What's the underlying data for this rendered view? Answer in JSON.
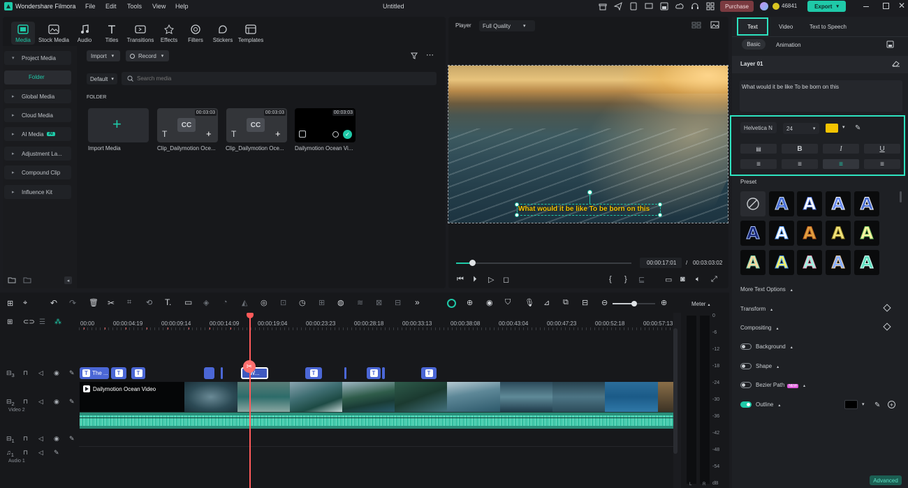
{
  "app": {
    "name": "Wondershare Filmora",
    "doc_title": "Untitled"
  },
  "menu": [
    "File",
    "Edit",
    "Tools",
    "View",
    "Help"
  ],
  "topbar": {
    "purchase": "Purchase",
    "credits": "46841",
    "export": "Export"
  },
  "media_tabs": [
    "Media",
    "Stock Media",
    "Audio",
    "Titles",
    "Transitions",
    "Effects",
    "Filters",
    "Stickers",
    "Templates"
  ],
  "sidebar": {
    "project_media": "Project Media",
    "folder": "Folder",
    "items": [
      "Global Media",
      "Cloud Media",
      "AI Media",
      "Adjustment La...",
      "Compound Clip",
      "Influence Kit"
    ],
    "ai_badge": "AI"
  },
  "media_toolbar": {
    "import": "Import",
    "record": "Record",
    "sort": "Default",
    "search_placeholder": "Search media"
  },
  "folder_label": "FOLDER",
  "media_items": [
    {
      "label": "Import Media",
      "duration": ""
    },
    {
      "label": "Clip_Dailymotion Oce...",
      "duration": "00:03:03",
      "tag": "CC"
    },
    {
      "label": "Clip_Dailymotion Oce...",
      "duration": "00:03:03",
      "tag": "CC"
    },
    {
      "label": "Dailymotion Ocean Vi...",
      "duration": "00:03:03"
    }
  ],
  "player": {
    "label": "Player",
    "quality": "Full Quality",
    "caption": "What would it be like To be born on this",
    "current_time": "00:00:17:01",
    "separator": "/",
    "total_time": "00:03:03:02",
    "progress": 0.09
  },
  "right_tabs": [
    "Text",
    "Video",
    "Text to Speech"
  ],
  "sub_tabs": [
    "Basic",
    "Animation"
  ],
  "layer": "Layer 01",
  "text_content": "What would it be like To be born on this",
  "font": {
    "family": "Helvetica N",
    "size": "24",
    "color": "#f5c400"
  },
  "format_buttons": [
    "B",
    "I",
    "U"
  ],
  "preset_label": "Preset",
  "sections": [
    "More Text Options",
    "Transform",
    "Compositing"
  ],
  "toggles": [
    {
      "label": "Background",
      "on": false
    },
    {
      "label": "Shape",
      "on": false
    },
    {
      "label": "Bezier Path",
      "on": false,
      "badge": "NEW"
    },
    {
      "label": "Outline",
      "on": true
    }
  ],
  "advanced": "Advanced",
  "timeline": {
    "ruler": [
      "00:00",
      "00:00:04:19",
      "00:00:09:14",
      "00:00:14:09",
      "00:00:19:04",
      "00:00:23:23",
      "00:00:28:18",
      "00:00:33:13",
      "00:00:38:08",
      "00:00:43:04",
      "00:00:47:23",
      "00:00:52:18",
      "00:00:57:13"
    ],
    "meter_label": "Meter",
    "meter_ticks": [
      "0",
      "-6",
      "-12",
      "-18",
      "-24",
      "-30",
      "-36",
      "-42",
      "-48",
      "-54",
      "dB"
    ],
    "meter_lr": [
      "L",
      "R"
    ],
    "tracks": [
      {
        "num": "3",
        "name": ""
      },
      {
        "num": "2",
        "name": "Video 2"
      },
      {
        "num": "1",
        "name": ""
      },
      {
        "num": "1",
        "name": "Audio 1"
      }
    ],
    "video_clip": "Dailymotion Ocean Video",
    "title_clip_first": "The ...",
    "title_clip_sel": "W..."
  },
  "colors": {
    "accent": "#1fc9a8",
    "playhead": "#ff5a5a",
    "title_clip": "#4b67d6",
    "audio": "#2fb99b"
  }
}
